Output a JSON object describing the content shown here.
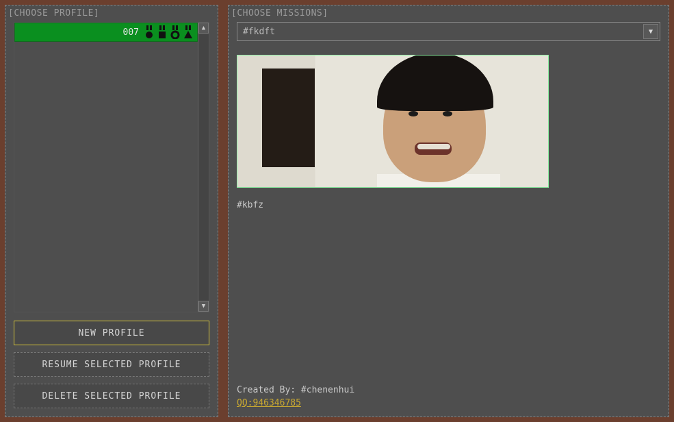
{
  "left": {
    "title": "[CHOOSE PROFILE]",
    "profiles": [
      {
        "name": "007"
      }
    ],
    "buttons": {
      "new": "NEW PROFILE",
      "resume": "RESUME SELECTED PROFILE",
      "delete": "DELETE SELECTED PROFILE"
    }
  },
  "right": {
    "title": "[CHOOSE MISSIONS]",
    "selected_mission": "#fkdft",
    "description": "#kbfz",
    "created_by_label": "Created By:",
    "created_by_value": "#chenenhui",
    "qq": "QQ:946346785"
  }
}
